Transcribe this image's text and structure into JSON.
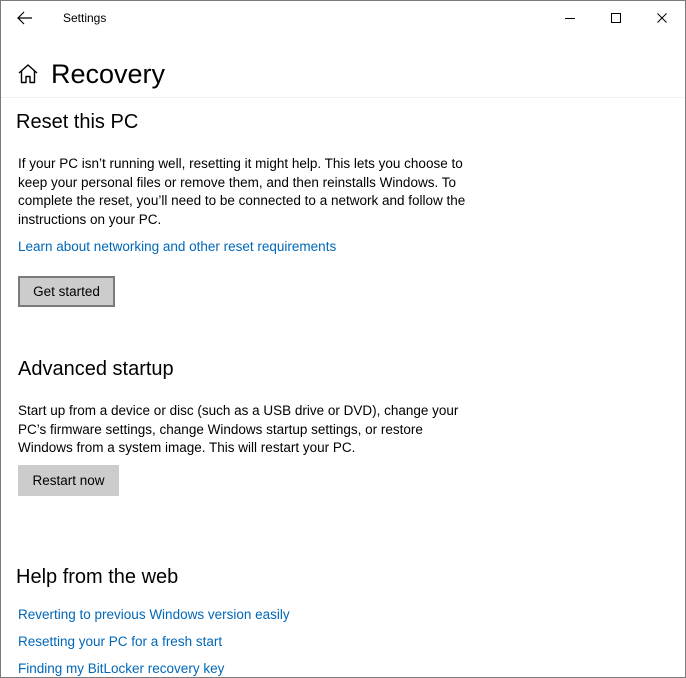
{
  "window": {
    "title": "Settings",
    "controls": {
      "back_icon": "arrow-left-icon",
      "minimize_icon": "minimize-icon",
      "maximize_icon": "maximize-icon",
      "close_icon": "close-icon"
    }
  },
  "header": {
    "home_icon": "home-icon",
    "title": "Recovery"
  },
  "reset_section": {
    "title": "Reset this PC",
    "description": "If your PC isn’t running well, resetting it might help. This lets you choose to keep your personal files or remove them, and then reinstalls Windows. To complete the reset, you’ll need to be connected to a network and follow the instructions on your PC.",
    "link": "Learn about networking and other reset requirements",
    "button": "Get started"
  },
  "advanced_section": {
    "title": "Advanced startup",
    "description": "Start up from a device or disc (such as a USB drive or DVD), change your PC’s firmware settings, change Windows startup settings, or restore Windows from a system image. This will restart your PC.",
    "button": "Restart now"
  },
  "help_section": {
    "title": "Help from the web",
    "links": [
      "Reverting to previous Windows version easily",
      "Resetting your PC for a fresh start",
      "Finding my BitLocker recovery key"
    ]
  },
  "colors": {
    "link": "#0067b8",
    "button_bg": "#cccccc",
    "focus_border": "#7a7a7a"
  }
}
